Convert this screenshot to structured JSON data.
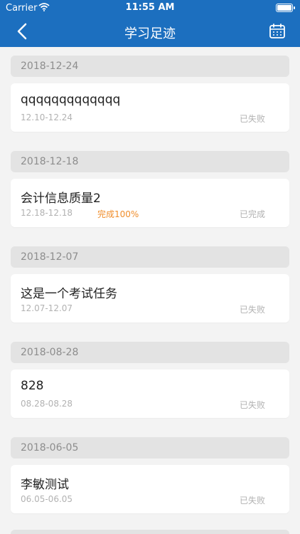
{
  "status_bar": {
    "carrier": "Carrier",
    "time": "11:55 AM"
  },
  "nav": {
    "title": "学习足迹",
    "back_icon": "chevron-left-icon",
    "calendar_icon": "calendar-icon"
  },
  "colors": {
    "nav_bg": "#1c6fbf",
    "progress": "#f08d2a",
    "page_bg": "#f3f3f3"
  },
  "groups": [
    {
      "date": "2018-12-24",
      "title": "qqqqqqqqqqqqq",
      "range": "12.10-12.24",
      "progress": "",
      "status": "已失败"
    },
    {
      "date": "2018-12-18",
      "title": "会计信息质量2",
      "range": "12.18-12.18",
      "progress": "完成100%",
      "status": "已完成"
    },
    {
      "date": "2018-12-07",
      "title": "这是一个考试任务",
      "range": "12.07-12.07",
      "progress": "",
      "status": "已失败"
    },
    {
      "date": "2018-08-28",
      "title": "828",
      "range": "08.28-08.28",
      "progress": "",
      "status": "已失败"
    },
    {
      "date": "2018-06-05",
      "title": "李敏测试",
      "range": "06.05-06.05",
      "progress": "",
      "status": "已失败"
    }
  ]
}
